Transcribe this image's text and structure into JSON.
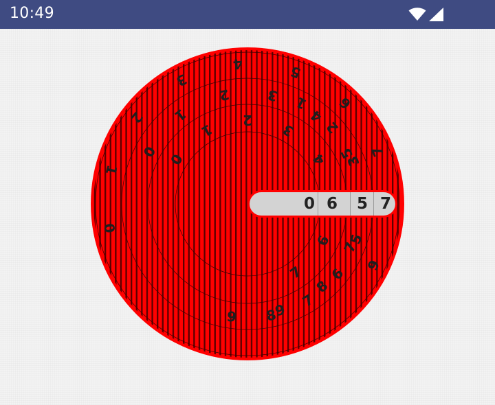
{
  "status_bar": {
    "time": "10:49",
    "background": "#3f4b82",
    "icons": [
      "wifi-icon",
      "cellular-signal-icon"
    ]
  },
  "dial": {
    "fill_color": "#ff0000",
    "stripe_color": "#5a0000",
    "rings": [
      {
        "name": "ring-1",
        "labels": [
          "0",
          "1",
          "2",
          "3",
          "4",
          "5",
          "6",
          "7"
        ]
      },
      {
        "name": "ring-2",
        "labels": [
          "0",
          "1",
          "2",
          "3",
          "4",
          "5",
          "6",
          "7",
          "8",
          "9"
        ]
      },
      {
        "name": "ring-3",
        "labels": [
          "1",
          "2",
          "3",
          "4",
          "5",
          "6",
          "7",
          "8",
          "9"
        ]
      },
      {
        "name": "ring-4",
        "labels": [
          "0",
          "1",
          "2",
          "3",
          "4",
          "5",
          "6",
          "7",
          "8",
          "9"
        ]
      }
    ]
  },
  "code": {
    "digits": [
      "0",
      "6",
      "5",
      "7"
    ]
  }
}
